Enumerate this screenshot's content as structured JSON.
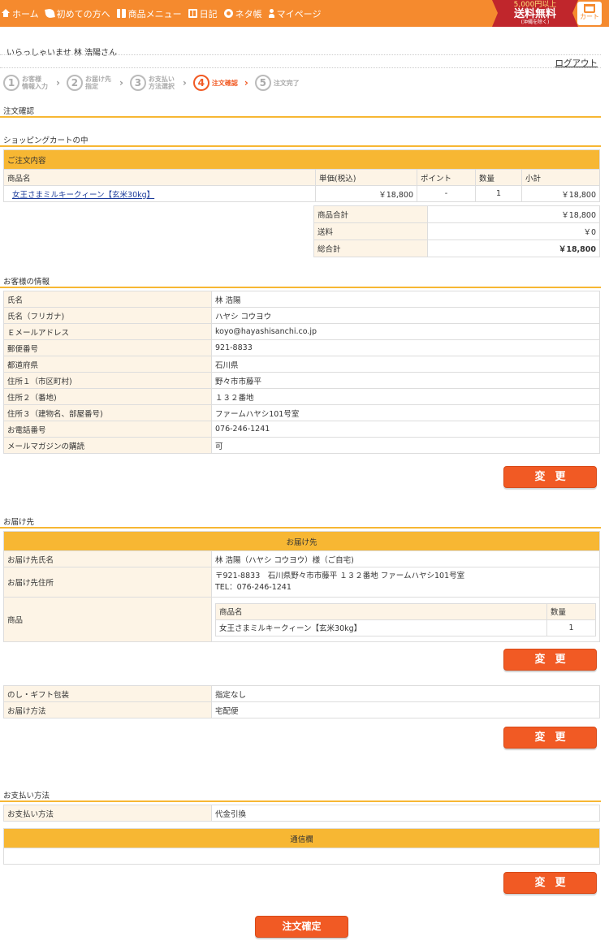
{
  "nav": {
    "items": [
      {
        "label": "ホーム",
        "icon": "home-icon"
      },
      {
        "label": "初めての方へ",
        "icon": "leaf-icon"
      },
      {
        "label": "商品メニュー",
        "icon": "gift-icon"
      },
      {
        "label": "日記",
        "icon": "book-icon"
      },
      {
        "label": "ネタ帳",
        "icon": "circle-icon"
      },
      {
        "label": "マイページ",
        "icon": "person-icon"
      }
    ],
    "banner": {
      "line1": "5,000円以上",
      "line2": "送料無料",
      "line3": "(沖縄を除く)"
    },
    "cart_label": "カート"
  },
  "welcome": "いらっしゃいませ  林 浩陽さん",
  "logout": "ログアウト",
  "steps": [
    {
      "num": "1",
      "line1": "お客様",
      "line2": "情報入力"
    },
    {
      "num": "2",
      "line1": "お届け先",
      "line2": "指定"
    },
    {
      "num": "3",
      "line1": "お支払い",
      "line2": "方法選択"
    },
    {
      "num": "4",
      "line1": "注文確認",
      "line2": ""
    },
    {
      "num": "5",
      "line1": "注文完了",
      "line2": ""
    }
  ],
  "page_title": "注文確認",
  "cart_section": {
    "title": "ショッピングカートの中",
    "header": "ご注文内容",
    "columns": [
      "商品名",
      "単価(税込)",
      "ポイント",
      "数量",
      "小計"
    ],
    "row": {
      "name": "女王さまミルキークィーン【玄米30kg】",
      "price": "￥18,800",
      "point": "-",
      "qty": "1",
      "subtotal": "￥18,800"
    },
    "totals": [
      {
        "label": "商品合計",
        "value": "￥18,800"
      },
      {
        "label": "送料",
        "value": "￥0"
      },
      {
        "label": "総合計",
        "value": "￥18,800"
      }
    ]
  },
  "customer": {
    "title": "お客様の情報",
    "rows": [
      {
        "label": "氏名",
        "value": "林 浩陽"
      },
      {
        "label": "氏名（フリガナ)",
        "value": "ハヤシ コウヨウ"
      },
      {
        "label": "Ｅメールアドレス",
        "value": "koyo@hayashisanchi.co.jp"
      },
      {
        "label": "郵便番号",
        "value": "921-8833"
      },
      {
        "label": "都道府県",
        "value": "石川県"
      },
      {
        "label": "住所１（市区町村)",
        "value": "野々市市藤平"
      },
      {
        "label": "住所２（番地)",
        "value": "１３２番地"
      },
      {
        "label": "住所３（建物名、部屋番号)",
        "value": "ファームハヤシ101号室"
      },
      {
        "label": "お電話番号",
        "value": "076-246-1241"
      },
      {
        "label": "メールマガジンの購読",
        "value": "可"
      }
    ],
    "button": "変更"
  },
  "delivery": {
    "title": "お届け先",
    "header": "お届け先",
    "name_label": "お届け先氏名",
    "name_value": "林 浩陽（ハヤシ コウヨウ）様（ご自宅)",
    "address_label": "お届け先住所",
    "address_line1": "〒921-8833　石川県野々市市藤平 １３２番地 ファームハヤシ101号室",
    "address_line2": "TEL：076-246-1241",
    "product_label": "商品",
    "product_col_name": "商品名",
    "product_col_qty": "数量",
    "product_name": "女王さまミルキークィーン【玄米30kg】",
    "product_qty": "1",
    "button": "変更"
  },
  "gift": {
    "rows": [
      {
        "label": "のし・ギフト包装",
        "value": "指定なし"
      },
      {
        "label": "お届け方法",
        "value": "宅配便"
      }
    ],
    "button": "変更"
  },
  "payment": {
    "title": "お支払い方法",
    "label": "お支払い方法",
    "value": "代金引換",
    "comm_header": "通信欄",
    "comm_value": "",
    "button": "変更"
  },
  "confirm_button": "注文確定"
}
